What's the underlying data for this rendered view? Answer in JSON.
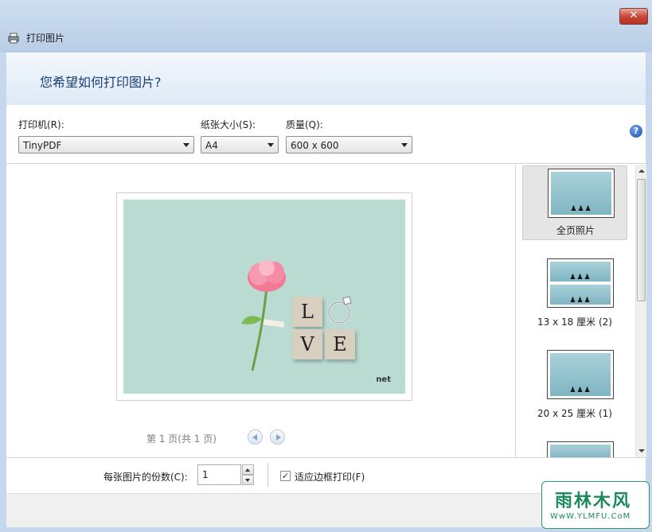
{
  "window": {
    "title": "打印图片",
    "close_label": "✕"
  },
  "header": {
    "question": "您希望如何打印图片?"
  },
  "options": {
    "printer": {
      "label": "打印机(R):",
      "value": "TinyPDF"
    },
    "paper": {
      "label": "纸张大小(S):",
      "value": "A4"
    },
    "quality": {
      "label": "质量(Q):",
      "value": "600 x 600"
    },
    "help_label": "?"
  },
  "preview": {
    "tiles": [
      "L",
      "V",
      "E"
    ],
    "watermark": "net",
    "page_info": "第 1 页(共 1 页)"
  },
  "layouts": [
    {
      "label": "全页照片",
      "selected": true
    },
    {
      "label": "13 x 18 厘米 (2)",
      "selected": false
    },
    {
      "label": "20 x 25 厘米 (1)",
      "selected": false
    }
  ],
  "bottom": {
    "copies_label": "每张图片的份数(C):",
    "copies_value": "1",
    "fit_label": "适应边框打印(F)",
    "fit_checked": true
  },
  "logo": {
    "line1": "雨林木风",
    "line2": "WwW.YLMFU.CoM"
  },
  "colors": {
    "accent": "#1b3e76",
    "photo_bg": "#b9dbd2"
  }
}
